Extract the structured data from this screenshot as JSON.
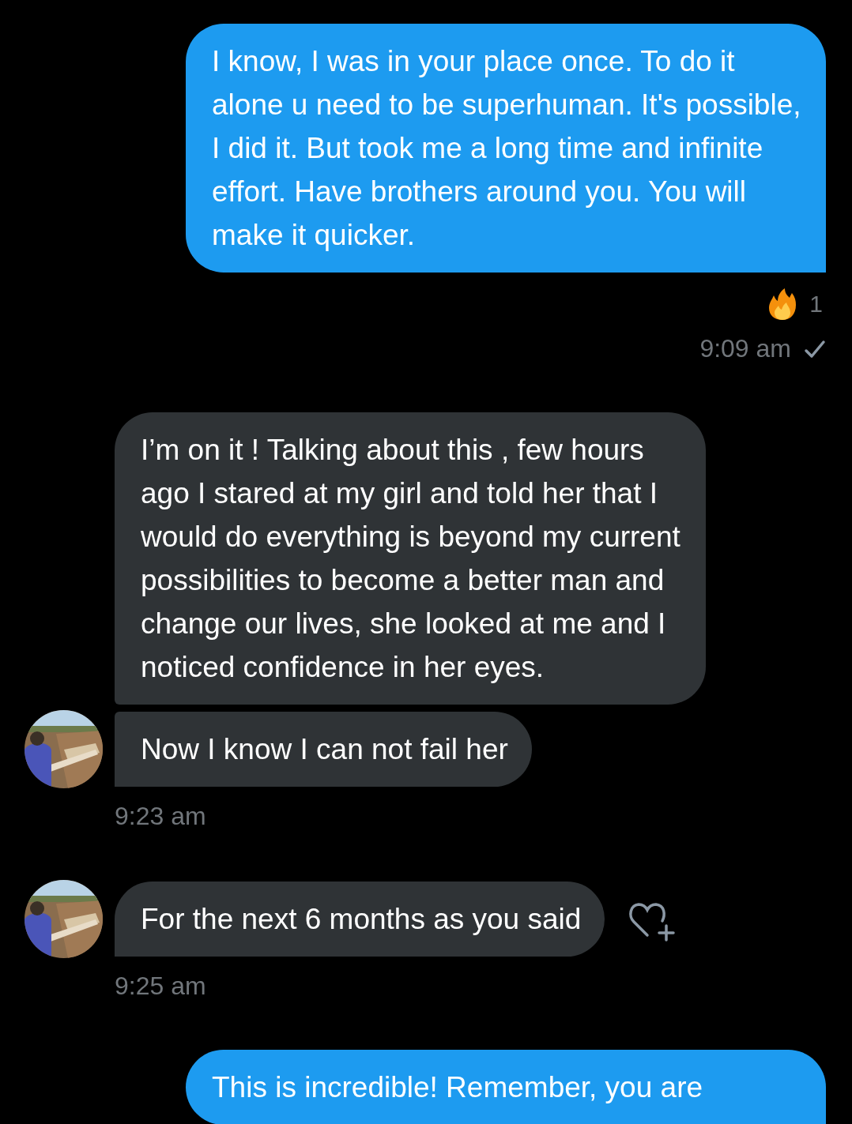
{
  "messages": [
    {
      "kind": "sent",
      "bubbles": [
        {
          "text": "I know, I was in your place once. To do it alone u need to be superhuman. It's possible, I did it. But took me a long time and infinite effort. Have brothers around you. You will make it quicker."
        }
      ],
      "reaction": {
        "count": "1"
      },
      "time": "9:09 am",
      "delivered": true
    },
    {
      "kind": "received",
      "bubbles": [
        {
          "text": "I’m on it ! Talking about this , few hours ago I stared at my girl and told her that I would do everything is beyond my current possibilities to become a better man and change our lives, she looked at me and I noticed confidence in her eyes."
        },
        {
          "text": "Now I know I can not fail her"
        }
      ],
      "time": "9:23 am"
    },
    {
      "kind": "received",
      "bubbles": [
        {
          "text": "For the next 6 months as you said"
        }
      ],
      "time": "9:25 am",
      "react_button": true
    },
    {
      "kind": "sent",
      "bubbles": [
        {
          "text": "This is incredible! Remember, you are"
        }
      ]
    }
  ]
}
